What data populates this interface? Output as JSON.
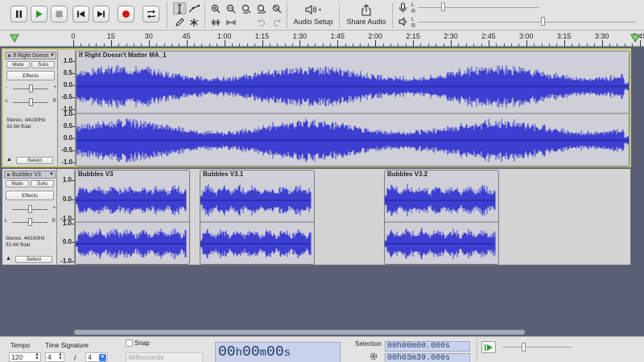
{
  "toolbar": {
    "audio_setup_label": "Audio Setup",
    "share_audio_label": "Share Audio",
    "meter_rec": [
      "L",
      "R"
    ],
    "meter_play": [
      "L",
      "R"
    ]
  },
  "ruler": {
    "labels": [
      "0",
      "15",
      "30",
      "45",
      "1:00",
      "1:15",
      "1:30",
      "1:45",
      "2:00",
      "2:15",
      "2:30",
      "2:45",
      "3:00",
      "3:15",
      "3:30",
      "3:45"
    ]
  },
  "tracks": [
    {
      "name": "If Right Doesn",
      "mute_label": "Mute",
      "solo_label": "Solo",
      "effects_label": "Effects",
      "gain_left": "-",
      "gain_right": "+",
      "pan_left": "L",
      "pan_right": "R",
      "info_line1": "Stereo, 44100Hz",
      "info_line2": "32-bit float",
      "select_label": "Select",
      "scale_labels": [
        "1.0",
        "0.5",
        "0.0",
        "-0.5",
        "-1.0"
      ],
      "clips": [
        {
          "name": "If Right Doesn't Matter MA_1"
        }
      ]
    },
    {
      "name": "Bubbles V3",
      "mute_label": "Mute",
      "solo_label": "Solo",
      "effects_label": "Effects",
      "gain_left": "-",
      "gain_right": "+",
      "pan_left": "L",
      "pan_right": "R",
      "info_line1": "Stereo, 44100Hz",
      "info_line2": "32-bit float",
      "select_label": "Select",
      "scale_labels": [
        "1.0",
        "0.0",
        "-1.0"
      ],
      "clips": [
        {
          "name": "Bubbles V3"
        },
        {
          "name": "Bubbles V3.1"
        },
        {
          "name": "Bubbles V3.2"
        }
      ]
    }
  ],
  "bottom": {
    "tempo_label": "Tempo",
    "tempo_value": "120",
    "time_signature_label": "Time Signature",
    "time_sig_num": "4",
    "time_sig_slash": "/",
    "time_sig_den": "4",
    "snap_label": "Snap",
    "snap_unit": "Milliseconds",
    "time_display": [
      "00",
      "h",
      "00",
      "m",
      "00",
      "s"
    ],
    "selection_label": "Selection",
    "selection_start": [
      "00",
      "h",
      "00",
      "m",
      "00.000",
      "s"
    ],
    "selection_end": [
      "00",
      "h",
      "03",
      "m",
      "39.000",
      "s"
    ]
  },
  "colors": {
    "waveform": "#3c3fd0",
    "background": "#5c6077",
    "selected_track_border": "#c8c873"
  }
}
